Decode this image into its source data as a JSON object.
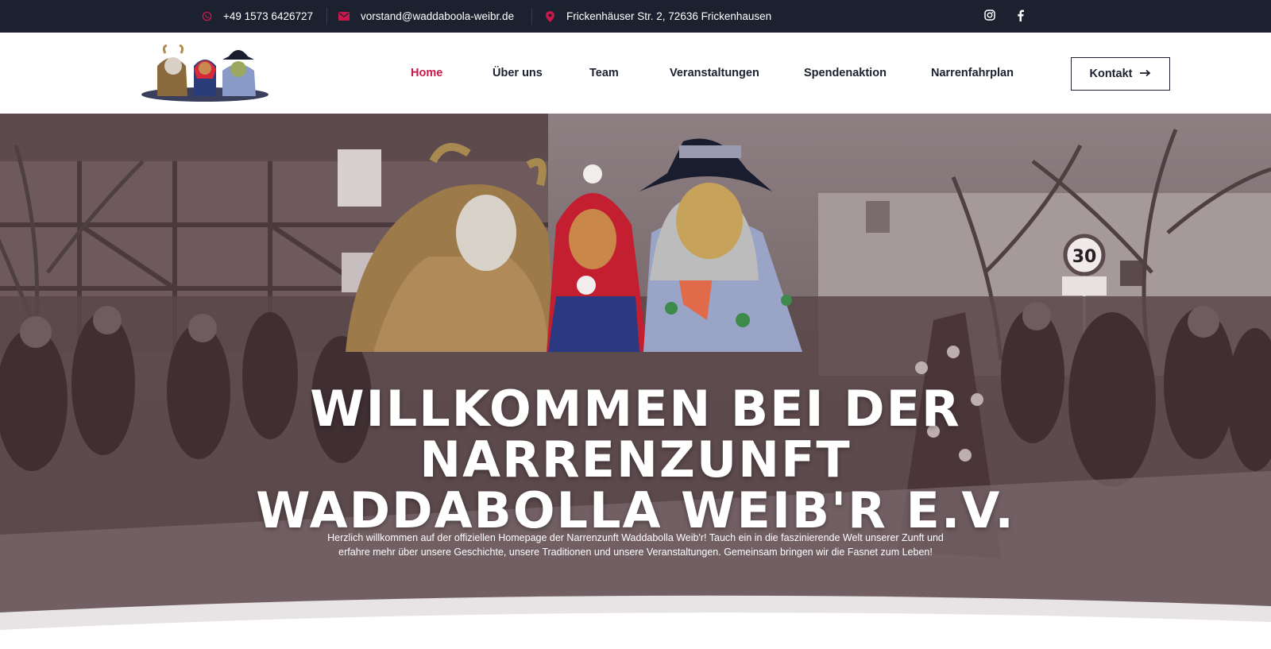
{
  "topbar": {
    "phone": "+49 1573 6426727",
    "email": "vorstand@waddaboola-weibr.de",
    "address": "Frickenhäuser Str. 2, 72636 Frickenhausen",
    "icons": [
      "whatsapp-icon",
      "mail-icon",
      "map-pin-icon",
      "instagram-icon",
      "facebook-icon"
    ]
  },
  "nav": {
    "items": [
      {
        "label": "Home",
        "active": true
      },
      {
        "label": "Über uns",
        "active": false
      },
      {
        "label": "Team",
        "active": false
      },
      {
        "label": "Veranstaltungen",
        "active": false
      },
      {
        "label": "Spendenaktion",
        "active": false
      },
      {
        "label": "Narrenfahrplan",
        "active": false
      }
    ],
    "cta_label": "Kontakt"
  },
  "hero": {
    "title_lines": [
      "WILLKOMMEN BEI DER",
      "NARRENZUNFT",
      "WADDABOLLA WEIB'R E.V."
    ],
    "subtitle_lines": [
      "Herzlich willkommen auf der offiziellen Homepage der Narrenzunft Waddabolla Weib'r! Tauch ein in die faszinierende Welt unserer Zunft und",
      "erfahre mehr über unsere Geschichte, unsere Traditionen und unsere Veranstaltungen. Gemeinsam bringen wir die Fasnet zum Leben!"
    ],
    "sign_text": "30"
  },
  "colors": {
    "topbar_bg": "#1c2130",
    "accent": "#c8194a",
    "nav_text": "#1c2130"
  }
}
